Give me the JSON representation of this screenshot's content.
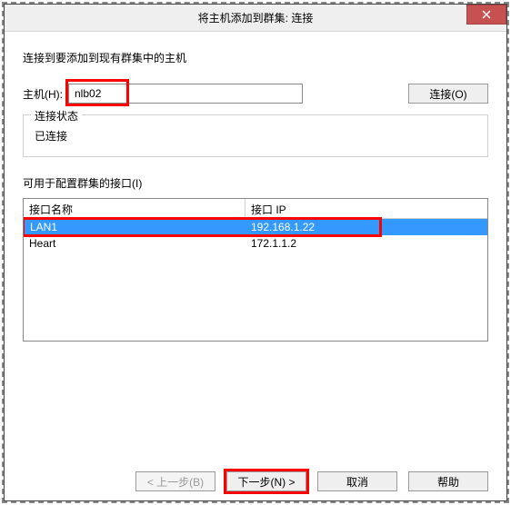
{
  "window": {
    "title": "将主机添加到群集: 连接",
    "close_tooltip": "关闭"
  },
  "page": {
    "instruction": "连接到要添加到现有群集中的主机",
    "host_label": "主机(H):",
    "host_value": "nlb02",
    "connect_button": "连接(O)"
  },
  "status_group": {
    "title": "连接状态",
    "text": "已连接"
  },
  "interfaces": {
    "label": "可用于配置群集的接口(I)",
    "columns": {
      "name": "接口名称",
      "ip": "接口 IP"
    },
    "rows": [
      {
        "name": "LAN1",
        "ip": "192.168.1.22",
        "selected": true
      },
      {
        "name": "Heart",
        "ip": "172.1.1.2",
        "selected": false
      }
    ]
  },
  "buttons": {
    "back": "< 上一步(B)",
    "next": "下一步(N) >",
    "cancel": "取消",
    "help": "帮助"
  }
}
